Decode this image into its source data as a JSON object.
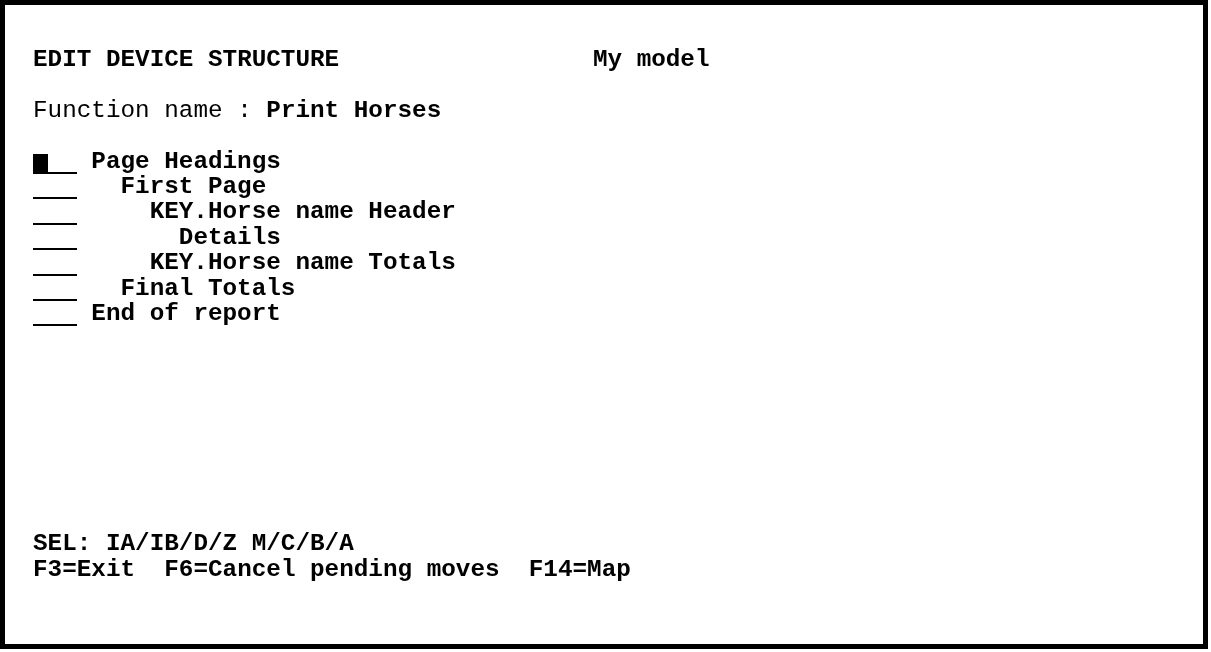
{
  "screen": {
    "title": "EDIT DEVICE STRUCTURE",
    "model": "My model"
  },
  "function": {
    "label": "Function name :",
    "value": "Print Horses"
  },
  "structure": [
    {
      "label": "Page Headings",
      "cursor": true,
      "children": [
        {
          "label": "First Page",
          "cursor": false,
          "children": [
            {
              "label": "KEY.Horse name Header",
              "cursor": false,
              "children": [
                {
                  "label": "Details",
                  "cursor": false
                }
              ]
            },
            {
              "label": "KEY.Horse name Totals",
              "cursor": false
            }
          ]
        },
        {
          "label": "Final Totals",
          "cursor": false
        }
      ]
    },
    {
      "label": "End of report",
      "cursor": false
    }
  ],
  "footer": {
    "selection_codes": "SEL: IA/IB/D/Z M/C/B/A",
    "function_keys": [
      "F3=Exit",
      "F6=Cancel pending moves",
      "F14=Map"
    ]
  }
}
